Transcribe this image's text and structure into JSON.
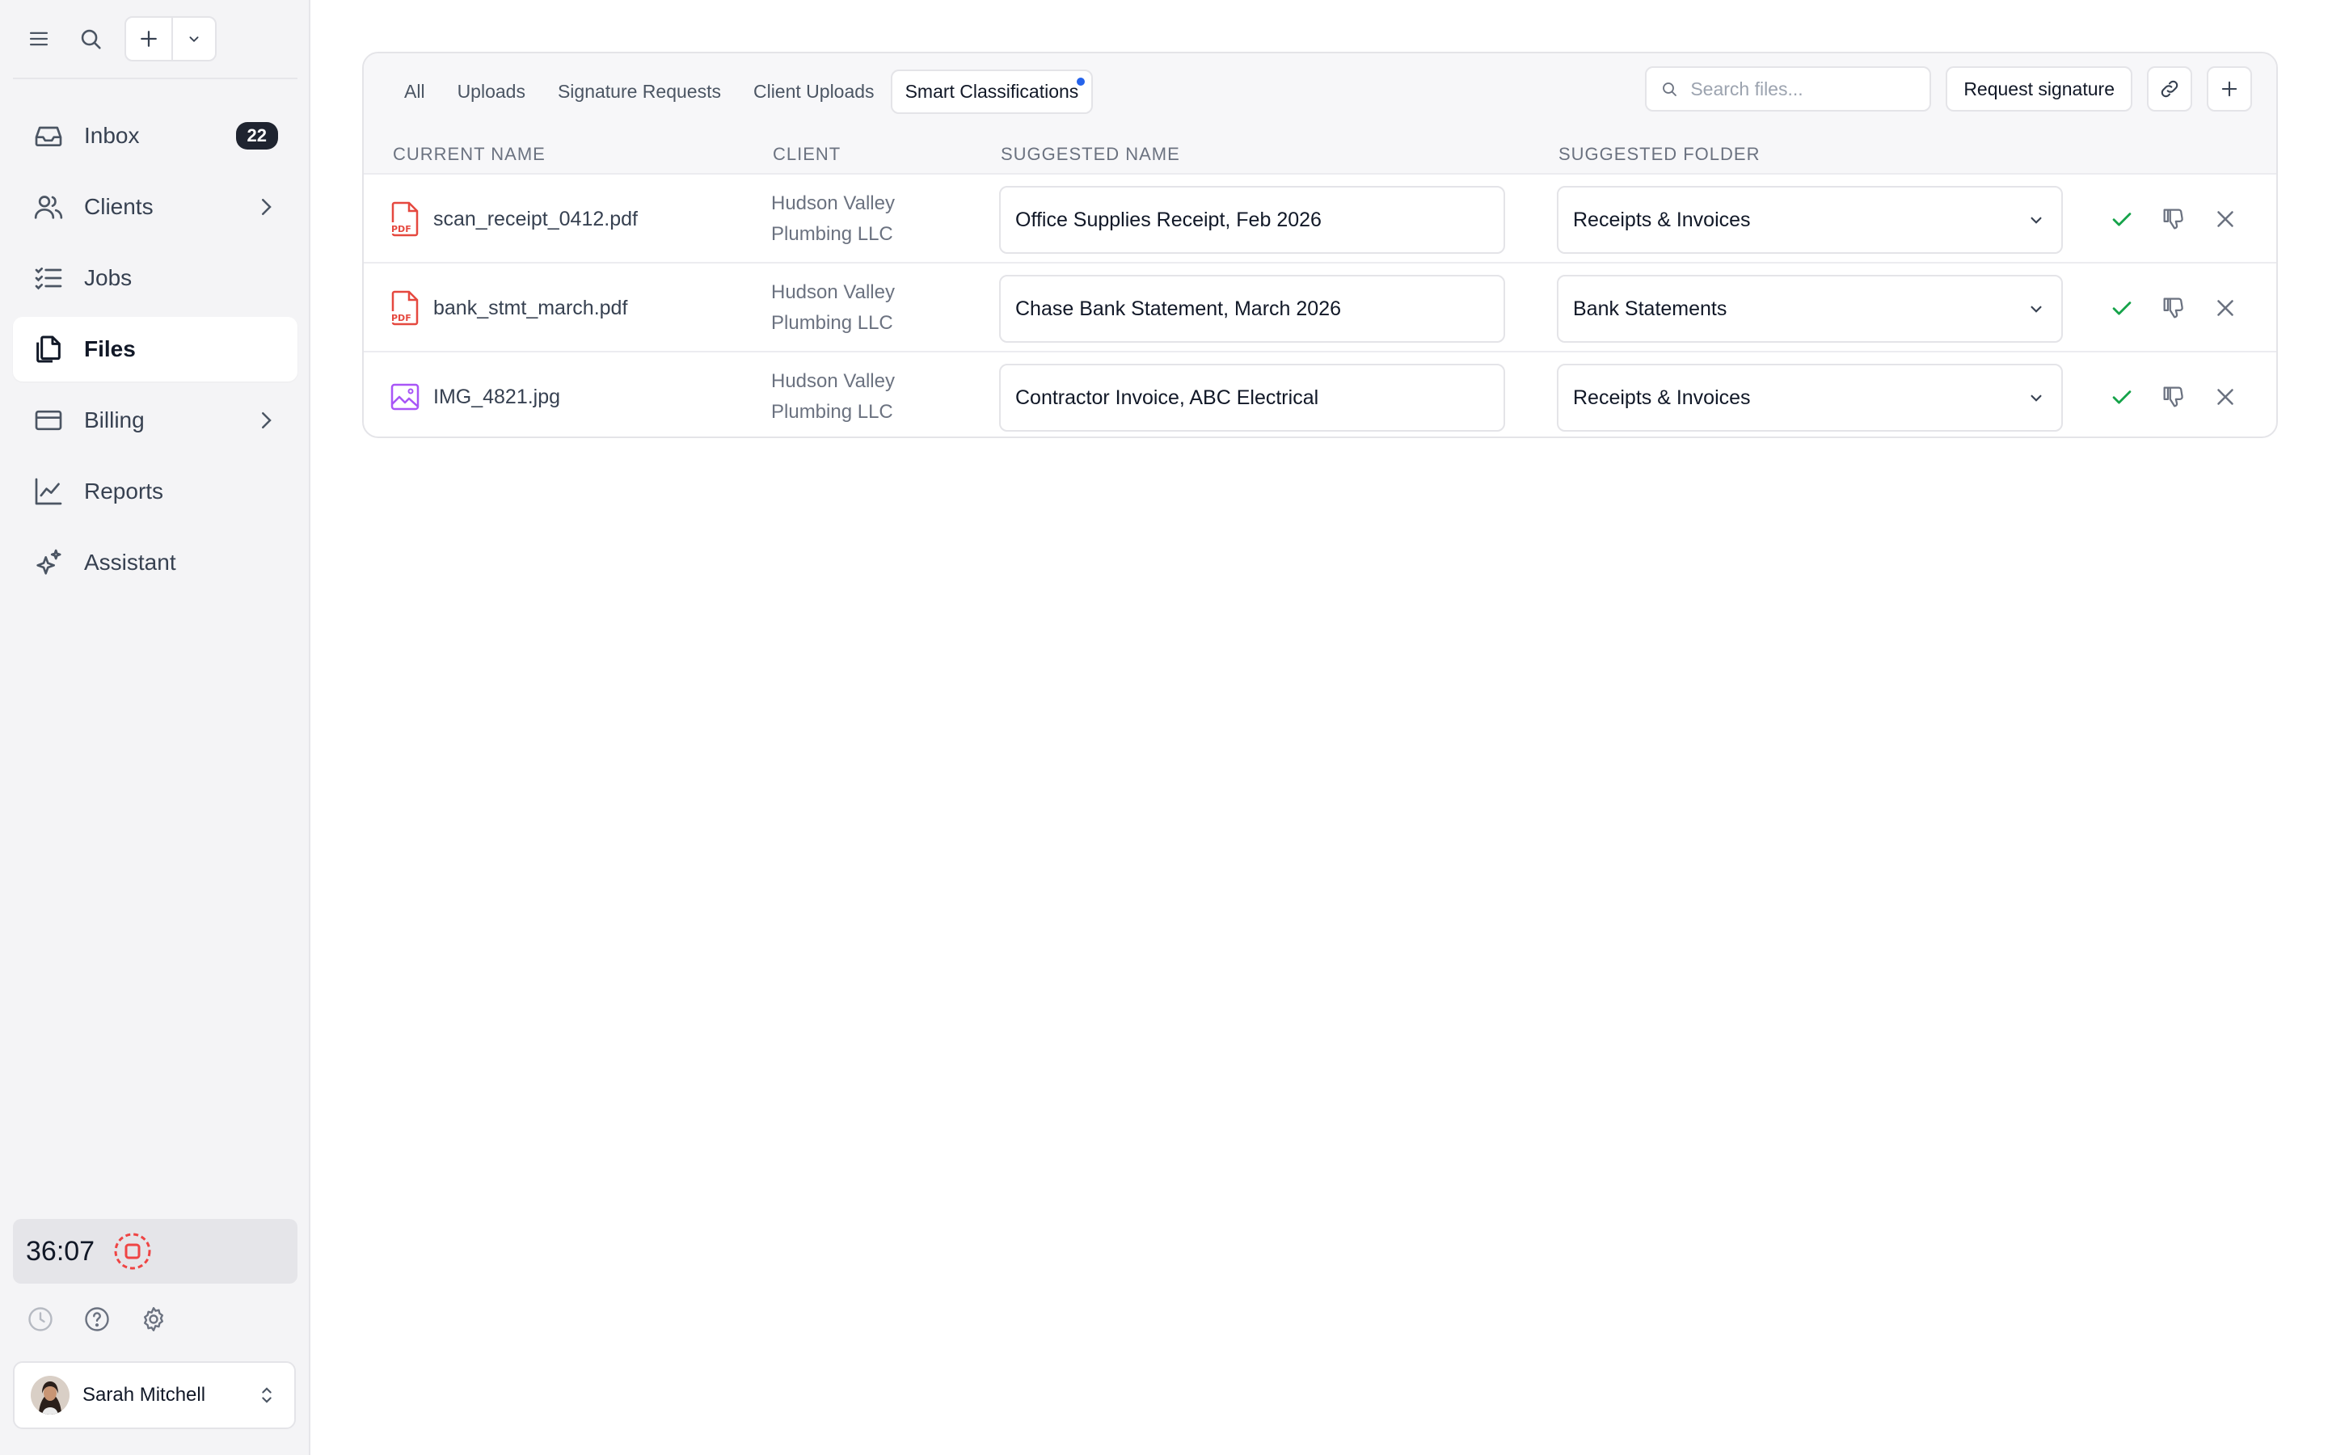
{
  "sidebar": {
    "nav": [
      {
        "label": "Inbox",
        "icon": "inbox-icon",
        "badge": "22"
      },
      {
        "label": "Clients",
        "icon": "users-icon"
      },
      {
        "label": "Jobs",
        "icon": "checklist-icon"
      },
      {
        "label": "Files",
        "icon": "files-icon",
        "active": true
      },
      {
        "label": "Billing",
        "icon": "credit-card-icon"
      },
      {
        "label": "Reports",
        "icon": "chart-line-icon"
      },
      {
        "label": "Assistant",
        "icon": "sparkles-icon"
      }
    ],
    "timer": "36:07",
    "user": {
      "name": "Sarah Mitchell"
    }
  },
  "main": {
    "tabs": [
      "All",
      "Uploads",
      "Signature Requests",
      "Client Uploads",
      "Smart Classifications"
    ],
    "search_placeholder": "Search files...",
    "request_signature_label": "Request signature",
    "columns": {
      "current_name": "CURRENT NAME",
      "client": "CLIENT",
      "suggested_name": "SUGGESTED NAME",
      "suggested_folder": "SUGGESTED FOLDER"
    },
    "rows": [
      {
        "file": "scan_receipt_0412.pdf",
        "type": "pdf",
        "client_line1": "Hudson Valley",
        "client_line2": "Plumbing LLC",
        "suggested_name": "Office Supplies Receipt, Feb 2026",
        "suggested_folder": "Receipts & Invoices"
      },
      {
        "file": "bank_stmt_march.pdf",
        "type": "pdf",
        "client_line1": "Hudson Valley",
        "client_line2": "Plumbing LLC",
        "suggested_name": "Chase Bank Statement, March 2026",
        "suggested_folder": "Bank Statements"
      },
      {
        "file": "IMG_4821.jpg",
        "type": "image",
        "client_line1": "Hudson Valley",
        "client_line2": "Plumbing LLC",
        "suggested_name": "Contractor Invoice, ABC Electrical",
        "suggested_folder": "Receipts & Invoices"
      }
    ]
  },
  "colors": {
    "accent": "#2563eb",
    "approve": "#16a34a",
    "pdf": "#e5483f",
    "image": "#a855f7",
    "timer_stop": "#ef4444"
  }
}
